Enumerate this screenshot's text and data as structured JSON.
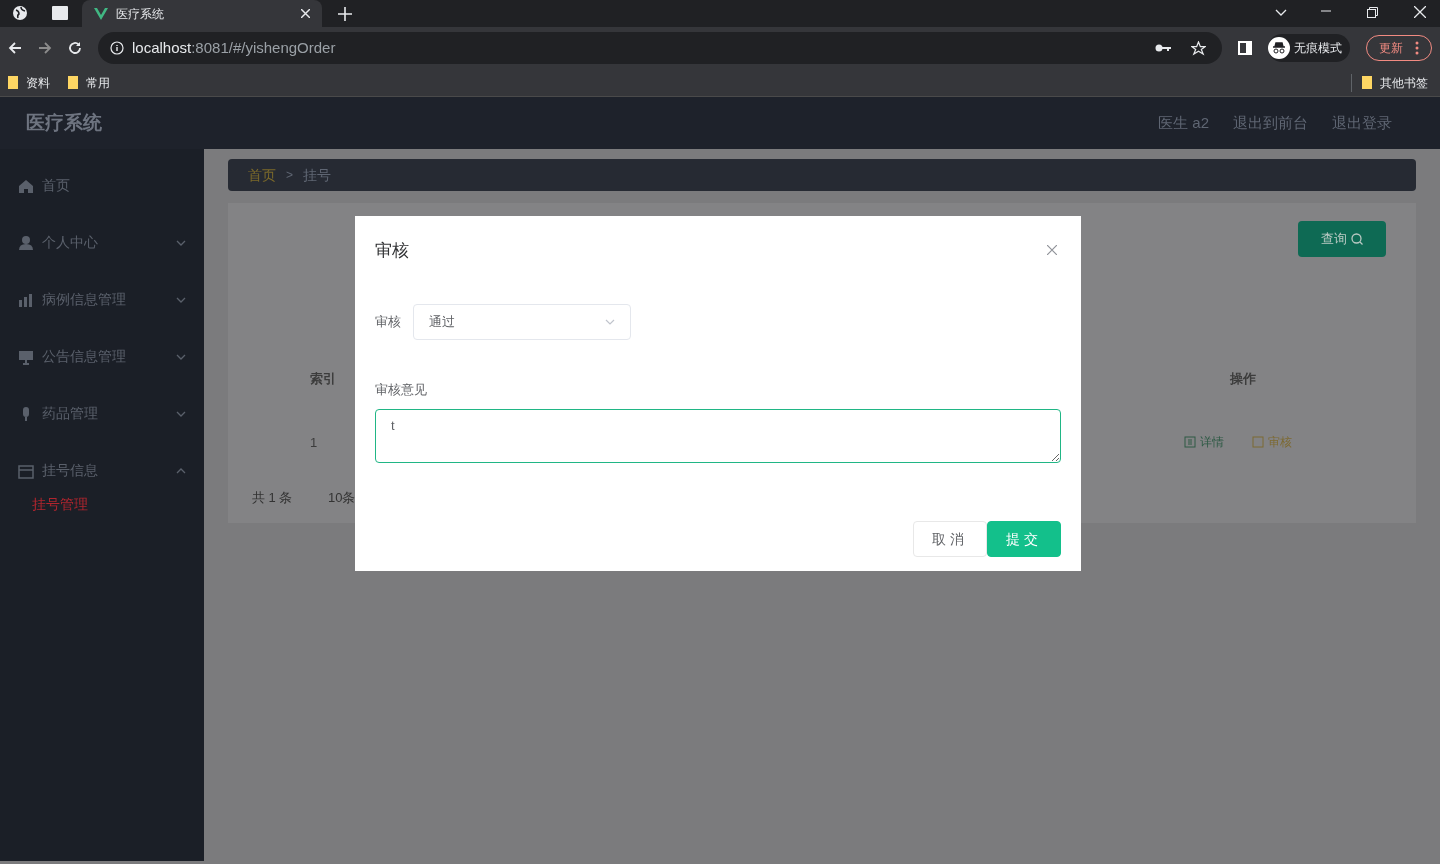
{
  "browser": {
    "tab_title": "医疗系统",
    "address": {
      "host": "localhost",
      "path": ":8081/#/yishengOrder"
    },
    "incognito_label": "无痕模式",
    "update_button": "更新",
    "bookmarks": [
      "资料",
      "常用"
    ],
    "other_bookmarks": "其他书签"
  },
  "app": {
    "title": "医疗系统",
    "header_links": [
      "医生 a2",
      "退出到前台",
      "退出登录"
    ]
  },
  "sidebar": {
    "items": [
      {
        "label": "首页"
      },
      {
        "label": "个人中心",
        "expanded": false
      },
      {
        "label": "病例信息管理",
        "expanded": false
      },
      {
        "label": "公告信息管理",
        "expanded": false
      },
      {
        "label": "药品管理",
        "expanded": false
      },
      {
        "label": "挂号信息",
        "expanded": true,
        "children": [
          {
            "label": "挂号管理",
            "selected": true
          }
        ]
      }
    ]
  },
  "breadcrumb_separator": ">",
  "breadcrumb": [
    {
      "label": "首页",
      "kind": "link"
    },
    {
      "label": "挂号",
      "kind": "current"
    }
  ],
  "search_button": "查询",
  "table": {
    "columns": [
      "索引",
      "操作"
    ],
    "rows": [
      {
        "index": "1",
        "actions": [
          {
            "label": "详情",
            "kind": "detail"
          },
          {
            "label": "审核",
            "kind": "review"
          }
        ]
      }
    ]
  },
  "pagination": {
    "total": "共 1 条",
    "page_size": "10条"
  },
  "dialog": {
    "title": "审核",
    "fields": [
      {
        "kind": "select",
        "label": "审核",
        "value": "通过"
      },
      {
        "kind": "textarea",
        "label": "审核意见",
        "value": "t"
      }
    ],
    "buttons": [
      {
        "label": "取消",
        "kind": "secondary"
      },
      {
        "label": "提交",
        "kind": "primary"
      }
    ]
  }
}
